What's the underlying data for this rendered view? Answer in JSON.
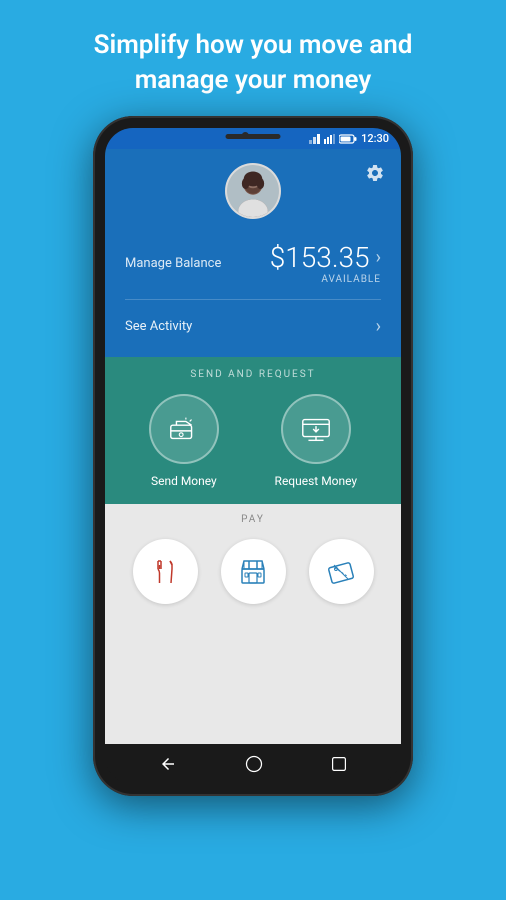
{
  "headline": {
    "line1": "Simplify how you move and",
    "line2": "manage your money"
  },
  "status_bar": {
    "time": "12:30"
  },
  "header": {
    "manage_balance_label": "Manage Balance",
    "balance_amount": "$153.35",
    "balance_available": "AVAILABLE",
    "see_activity_label": "See Activity"
  },
  "send_request": {
    "section_title": "SEND AND REQUEST",
    "send_money_label": "Send Money",
    "request_money_label": "Request Money"
  },
  "pay": {
    "section_title": "PAY",
    "items": [
      {
        "name": "restaurant",
        "label": ""
      },
      {
        "name": "store",
        "label": ""
      },
      {
        "name": "coupon",
        "label": ""
      }
    ]
  },
  "nav": {
    "back": "◁",
    "home": "○",
    "recent": "□"
  }
}
